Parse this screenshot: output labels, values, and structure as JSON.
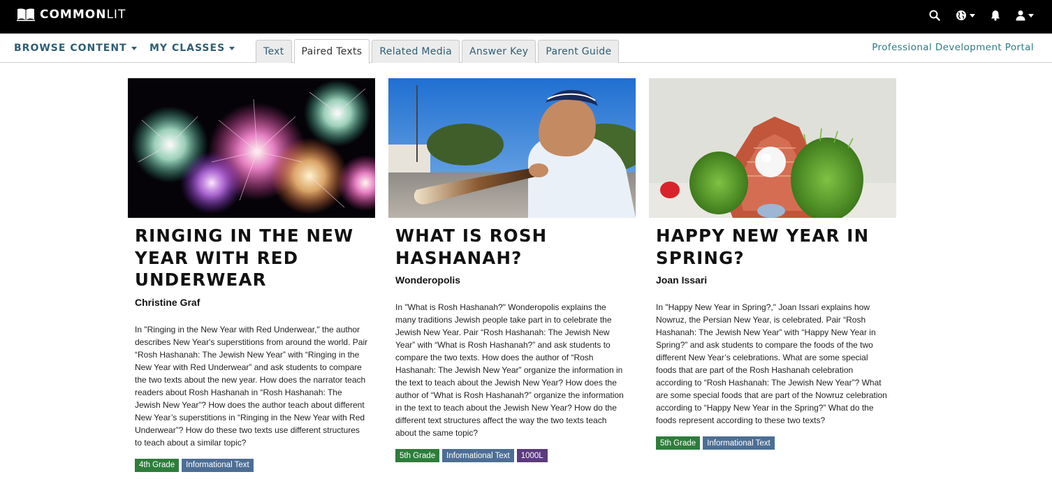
{
  "header": {
    "logo_text_bold": "COMMON",
    "logo_text_light": "LIT",
    "icons": [
      "search-icon",
      "globe-icon",
      "bell-icon",
      "user-icon"
    ]
  },
  "nav": {
    "browse_content": "BROWSE CONTENT",
    "my_classes": "MY CLASSES",
    "tabs": [
      {
        "label": "Text",
        "active": false
      },
      {
        "label": "Paired Texts",
        "active": true
      },
      {
        "label": "Related Media",
        "active": false
      },
      {
        "label": "Answer Key",
        "active": false
      },
      {
        "label": "Parent Guide",
        "active": false
      }
    ],
    "professional_portal": "Professional Development Portal"
  },
  "colors": {
    "accent": "#2f5e73",
    "grade_tag": "#2e7d3b",
    "genre_tag": "#4d6e94",
    "lexile_tag": "#5c3a7e"
  },
  "cards": [
    {
      "image": "fireworks-image",
      "title": "RINGING IN THE NEW YEAR WITH RED UNDERWEAR",
      "author": "Christine Graf",
      "description": "In \"Ringing in the New Year with Red Underwear,\" the author describes New Year's superstitions from around the world. Pair “Rosh Hashanah: The Jewish New Year” with “Ringing in the New Year with Red Underwear” and ask students to compare the two texts about the new year. How does the narrator teach readers about Rosh Hashanah in “Rosh Hashanah: The Jewish New Year”? How does the author teach about different New Year’s superstitions in “Ringing in the New Year with Red Underwear”? How do these two texts use different structures to teach about a similar topic?",
      "tags": {
        "grade": "4th Grade",
        "genre": "Informational Text"
      }
    },
    {
      "image": "shofar-boy-image",
      "title": "WHAT IS ROSH HASHANAH?",
      "author": "Wonderopolis",
      "description": "In \"What is Rosh Hashanah?\" Wonderopolis explains the many traditions Jewish people take part in to celebrate the Jewish New Year. Pair “Rosh Hashanah: The Jewish New Year” with “What is Rosh Hashanah?” and ask students to compare the two texts. How does the author of “Rosh Hashanah: The Jewish New Year” organize the information in the text to teach about the Jewish New Year? How does the author of “What is Rosh Hashanah?” organize the information in the text to teach about the Jewish New Year? How do the different text structures affect the way the two texts teach about the same topic?",
      "tags": {
        "grade": "5th Grade",
        "genre": "Informational Text",
        "lexile": "1000L"
      }
    },
    {
      "image": "nowruz-table-image",
      "title": "HAPPY NEW YEAR IN SPRING?",
      "author": "Joan Issari",
      "description": "In \"Happy New Year in Spring?,\" Joan Issari explains how Nowruz, the Persian New Year, is celebrated. Pair “Rosh Hashanah: The Jewish New Year” with “Happy New Year in Spring?” and ask students to compare the foods of the two different New Year’s celebrations. What are some special foods that are part of the Rosh Hashanah celebration according to “Rosh Hashanah: The Jewish New Year”? What are some special foods that are part of the Nowruz celebration according to “Happy New Year in the Spring?” What do the foods represent according to these two texts?",
      "tags": {
        "grade": "5th Grade",
        "genre": "Informational Text"
      }
    }
  ]
}
